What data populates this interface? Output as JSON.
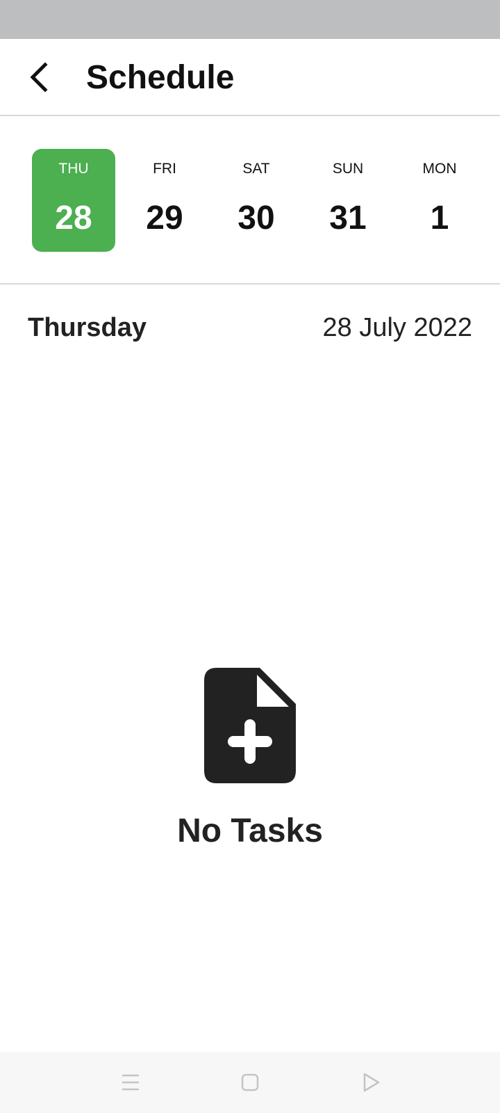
{
  "header": {
    "title": "Schedule",
    "back_icon": "chevron-left-icon"
  },
  "day_strip": {
    "selected_color": "#4caf50",
    "days": [
      {
        "dow": "THU",
        "num": "28",
        "selected": true
      },
      {
        "dow": "FRI",
        "num": "29",
        "selected": false
      },
      {
        "dow": "SAT",
        "num": "30",
        "selected": false
      },
      {
        "dow": "SUN",
        "num": "31",
        "selected": false
      },
      {
        "dow": "MON",
        "num": "1",
        "selected": false
      }
    ]
  },
  "selected_date": {
    "weekday": "Thursday",
    "full_date": "28 July 2022"
  },
  "empty_state": {
    "icon": "add-document-icon",
    "text": "No Tasks"
  },
  "system_nav": {
    "icons": [
      "menu-icon",
      "home-square-icon",
      "back-triangle-icon"
    ]
  }
}
